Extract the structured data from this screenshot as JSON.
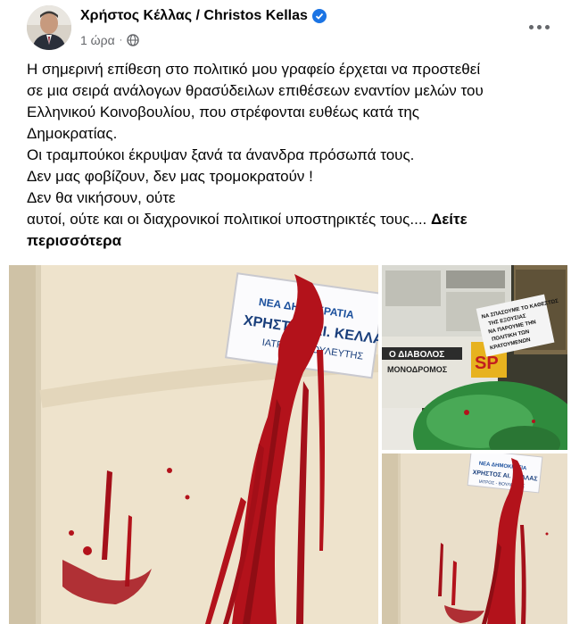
{
  "post": {
    "author": "Χρήστος Κέλλας / Christos Kellas",
    "time": "1 ώρα",
    "separator": "·",
    "lines": [
      "Η σημερινή επίθεση στο πολιτικό μου γραφείο έρχεται να προστεθεί",
      "σε μια σειρά ανάλογων θρασύδειλων επιθέσεων εναντίον μελών του",
      "Ελληνικού Κοινοβουλίου, που στρέφονται ευθέως κατά της",
      "Δημοκρατίας.",
      "Οι τραμπούκοι έκρυψαν ξανά τα άνανδρα πρόσωπά τους.",
      "Δεν μας  φοβίζουν, δεν μας τρομοκρατούν !",
      "Δεν θα νικήσουν, ούτε",
      "αυτοί, ούτε και οι διαχρονικοί πολιτικοί υποστηρικτές τους....",
      "περισσότερα"
    ],
    "see_more_prefix": "Δείτε",
    "icons": {
      "verified": "verified-badge-icon",
      "audience": "globe-icon",
      "more": "more-options-icon"
    }
  },
  "photos": {
    "sign_text": [
      "ΝΕΑ ΔΗΜΟΚΡΑΤΙΑ",
      "ΧΡΗΣΤΟΣ ΑΙ. ΚΕΛΛΑΣ",
      "ΙΑΤΡΟΣ - ΒΟΥΛΕΥΤΗΣ"
    ],
    "note_text": [
      "ΝΑ ΣΠΑΣΟΥΜΕ ΤΟ ΚΑΘΕΣΤΩΣ",
      "ΤΗΣ ΕΞΟΥΣΙΑΣ",
      "ΝΑ ΠΑΡΟΥΜΕ ΤΗΝ",
      "ΠΟΛΙΤΙΚΗ ΤΩΝ",
      "ΚΡΑΤΟΥΜΕΝΩΝ"
    ],
    "newspaper_text": [
      "Ο ΔΙΑΒΟΛΟΣ",
      "ΜΟΝΟΔΡΟΜΟΣ",
      "SP"
    ],
    "accent_paint": "#b3121b",
    "wall": "#ede1c8"
  }
}
